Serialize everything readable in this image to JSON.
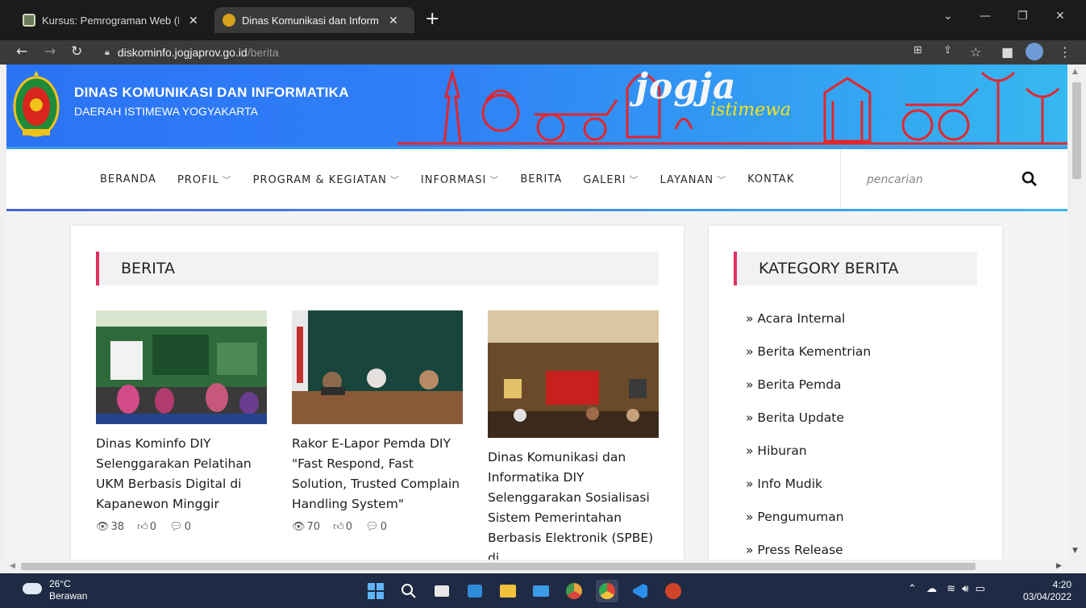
{
  "browser": {
    "tabs": [
      {
        "title": "Kursus: Pemrograman Web (Herr",
        "active": false
      },
      {
        "title": "Dinas Komunikasi dan Informatik",
        "active": true
      }
    ],
    "url_host": "diskominfo.jogjaprov.go.id",
    "url_path": "/berita"
  },
  "site": {
    "org_name": "DINAS KOMUNIKASI DAN INFORMATIKA",
    "org_subtitle": "DAERAH ISTIMEWA YOGYAKARTA",
    "banner_word": "jogja",
    "banner_sub": "istimewa"
  },
  "nav": {
    "items": [
      {
        "label": "BERANDA",
        "dropdown": false
      },
      {
        "label": "PROFIL",
        "dropdown": true
      },
      {
        "label": "PROGRAM & KEGIATAN",
        "dropdown": true
      },
      {
        "label": "INFORMASI",
        "dropdown": true
      },
      {
        "label": "BERITA",
        "dropdown": false
      },
      {
        "label": "GALERI",
        "dropdown": true
      },
      {
        "label": "LAYANAN",
        "dropdown": true
      },
      {
        "label": "KONTAK",
        "dropdown": false
      }
    ],
    "search_placeholder": "pencarian"
  },
  "main": {
    "heading": "BERITA",
    "posts": [
      {
        "title": "Dinas Kominfo DIY Selenggarakan Pelatihan UKM Berbasis Digital di Kapanewon Minggir",
        "views": "38",
        "likes": "0",
        "comments": "0"
      },
      {
        "title": "Rakor E-Lapor Pemda DIY \"Fast Respond, Fast Solution, Trusted Complain Handling System\"",
        "views": "70",
        "likes": "0",
        "comments": "0"
      },
      {
        "title": "Dinas Komunikasi dan Informatika DIY Selenggarakan Sosialisasi Sistem Pemerintahan Berbasis Elektronik (SPBE) di"
      }
    ]
  },
  "sidebar": {
    "heading": "KATEGORY BERITA",
    "categories": [
      "» Acara Internal",
      "» Berita Kementrian",
      "» Berita Pemda",
      "» Berita Update",
      "» Hiburan",
      "» Info Mudik",
      "» Pengumuman",
      "» Press Release"
    ]
  },
  "taskbar": {
    "temperature": "26°C",
    "weather": "Berawan",
    "time": "4:20",
    "date": "03/04/2022"
  },
  "colors": {
    "accent": "#e0305f",
    "banner_blue": "#2f7ff6",
    "banner_red": "#e3262c",
    "taskbar": "#1f2a44"
  }
}
